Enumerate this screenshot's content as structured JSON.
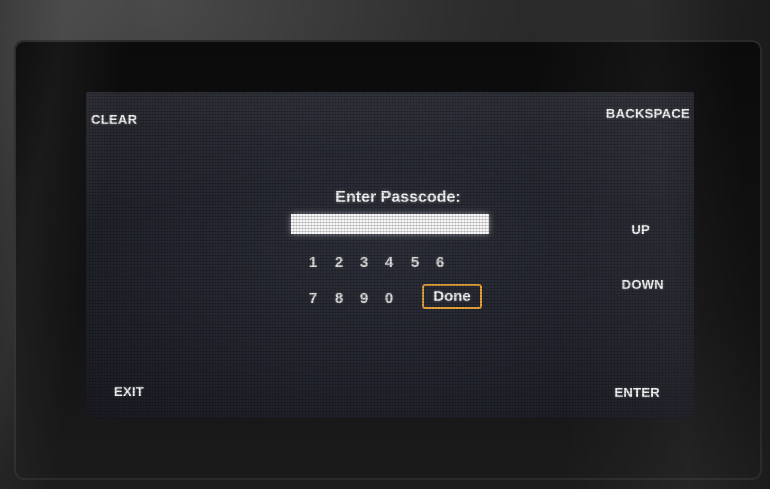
{
  "softkeys": {
    "clear": "CLEAR",
    "backspace": "BACKSPACE",
    "up": "UP",
    "down": "DOWN",
    "exit": "EXIT",
    "enter": "ENTER"
  },
  "dialog": {
    "prompt": "Enter Passcode:",
    "passcode_value": ""
  },
  "keypad": {
    "row1": [
      "1",
      "2",
      "3",
      "4",
      "5",
      "6"
    ],
    "row2": [
      "7",
      "8",
      "9",
      "0"
    ],
    "done_label": "Done",
    "highlight_color": "#e8a23a"
  }
}
